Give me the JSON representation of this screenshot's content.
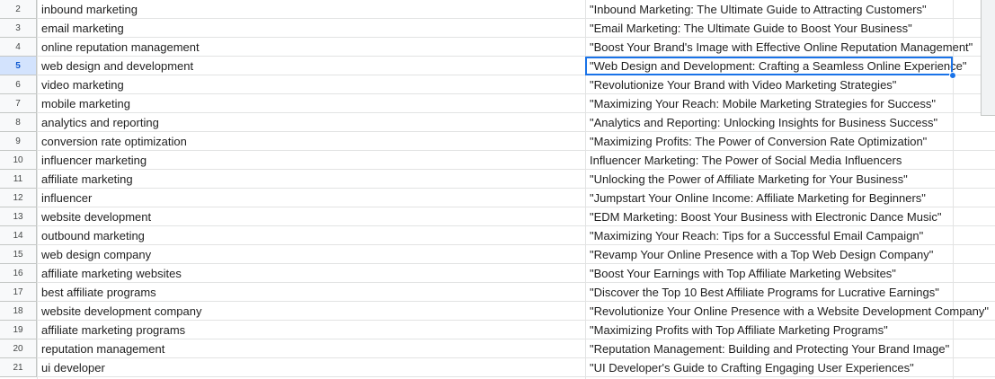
{
  "active_row": "5",
  "rows": [
    {
      "num": "2",
      "keyword": "inbound marketing",
      "title": "\"Inbound Marketing: The Ultimate Guide to Attracting Customers\""
    },
    {
      "num": "3",
      "keyword": "email marketing",
      "title": "\"Email Marketing: The Ultimate Guide to Boost Your Business\""
    },
    {
      "num": "4",
      "keyword": "online reputation management",
      "title": "\"Boost Your Brand's Image with Effective Online Reputation Management\""
    },
    {
      "num": "5",
      "keyword": "web design and development",
      "title": "\"Web Design and Development: Crafting a Seamless Online Experience\""
    },
    {
      "num": "6",
      "keyword": "video marketing",
      "title": "\"Revolutionize Your Brand with Video Marketing Strategies\""
    },
    {
      "num": "7",
      "keyword": "mobile marketing",
      "title": "\"Maximizing Your Reach: Mobile Marketing Strategies for Success\""
    },
    {
      "num": "8",
      "keyword": "analytics and reporting",
      "title": "\"Analytics and Reporting: Unlocking Insights for Business Success\""
    },
    {
      "num": "9",
      "keyword": "conversion rate optimization",
      "title": "\"Maximizing Profits: The Power of Conversion Rate Optimization\""
    },
    {
      "num": "10",
      "keyword": "influencer marketing",
      "title": "Influencer Marketing: The Power of Social Media Influencers"
    },
    {
      "num": "11",
      "keyword": "affiliate marketing",
      "title": "\"Unlocking the Power of Affiliate Marketing for Your Business\""
    },
    {
      "num": "12",
      "keyword": "influencer",
      "title": "\"Jumpstart Your Online Income: Affiliate Marketing for Beginners\""
    },
    {
      "num": "13",
      "keyword": "website development",
      "title": "\"EDM Marketing: Boost Your Business with Electronic Dance Music\""
    },
    {
      "num": "14",
      "keyword": "outbound marketing",
      "title": "\"Maximizing Your Reach: Tips for a Successful Email Campaign\""
    },
    {
      "num": "15",
      "keyword": "web design company",
      "title": "\"Revamp Your Online Presence with a Top Web Design Company\""
    },
    {
      "num": "16",
      "keyword": "affiliate marketing websites",
      "title": "\"Boost Your Earnings with Top Affiliate Marketing Websites\""
    },
    {
      "num": "17",
      "keyword": "best affiliate programs",
      "title": "\"Discover the Top 10 Best Affiliate Programs for Lucrative Earnings\""
    },
    {
      "num": "18",
      "keyword": "website development company",
      "title": "\"Revolutionize Your Online Presence with a Website Development Company\""
    },
    {
      "num": "19",
      "keyword": "affiliate marketing programs",
      "title": "\"Maximizing Profits with Top Affiliate Marketing Programs\""
    },
    {
      "num": "20",
      "keyword": "reputation management",
      "title": "\"Reputation Management: Building and Protecting Your Brand Image\""
    },
    {
      "num": "21",
      "keyword": "ui developer",
      "title": "\"UI Developer's Guide to Crafting Engaging User Experiences\""
    }
  ]
}
